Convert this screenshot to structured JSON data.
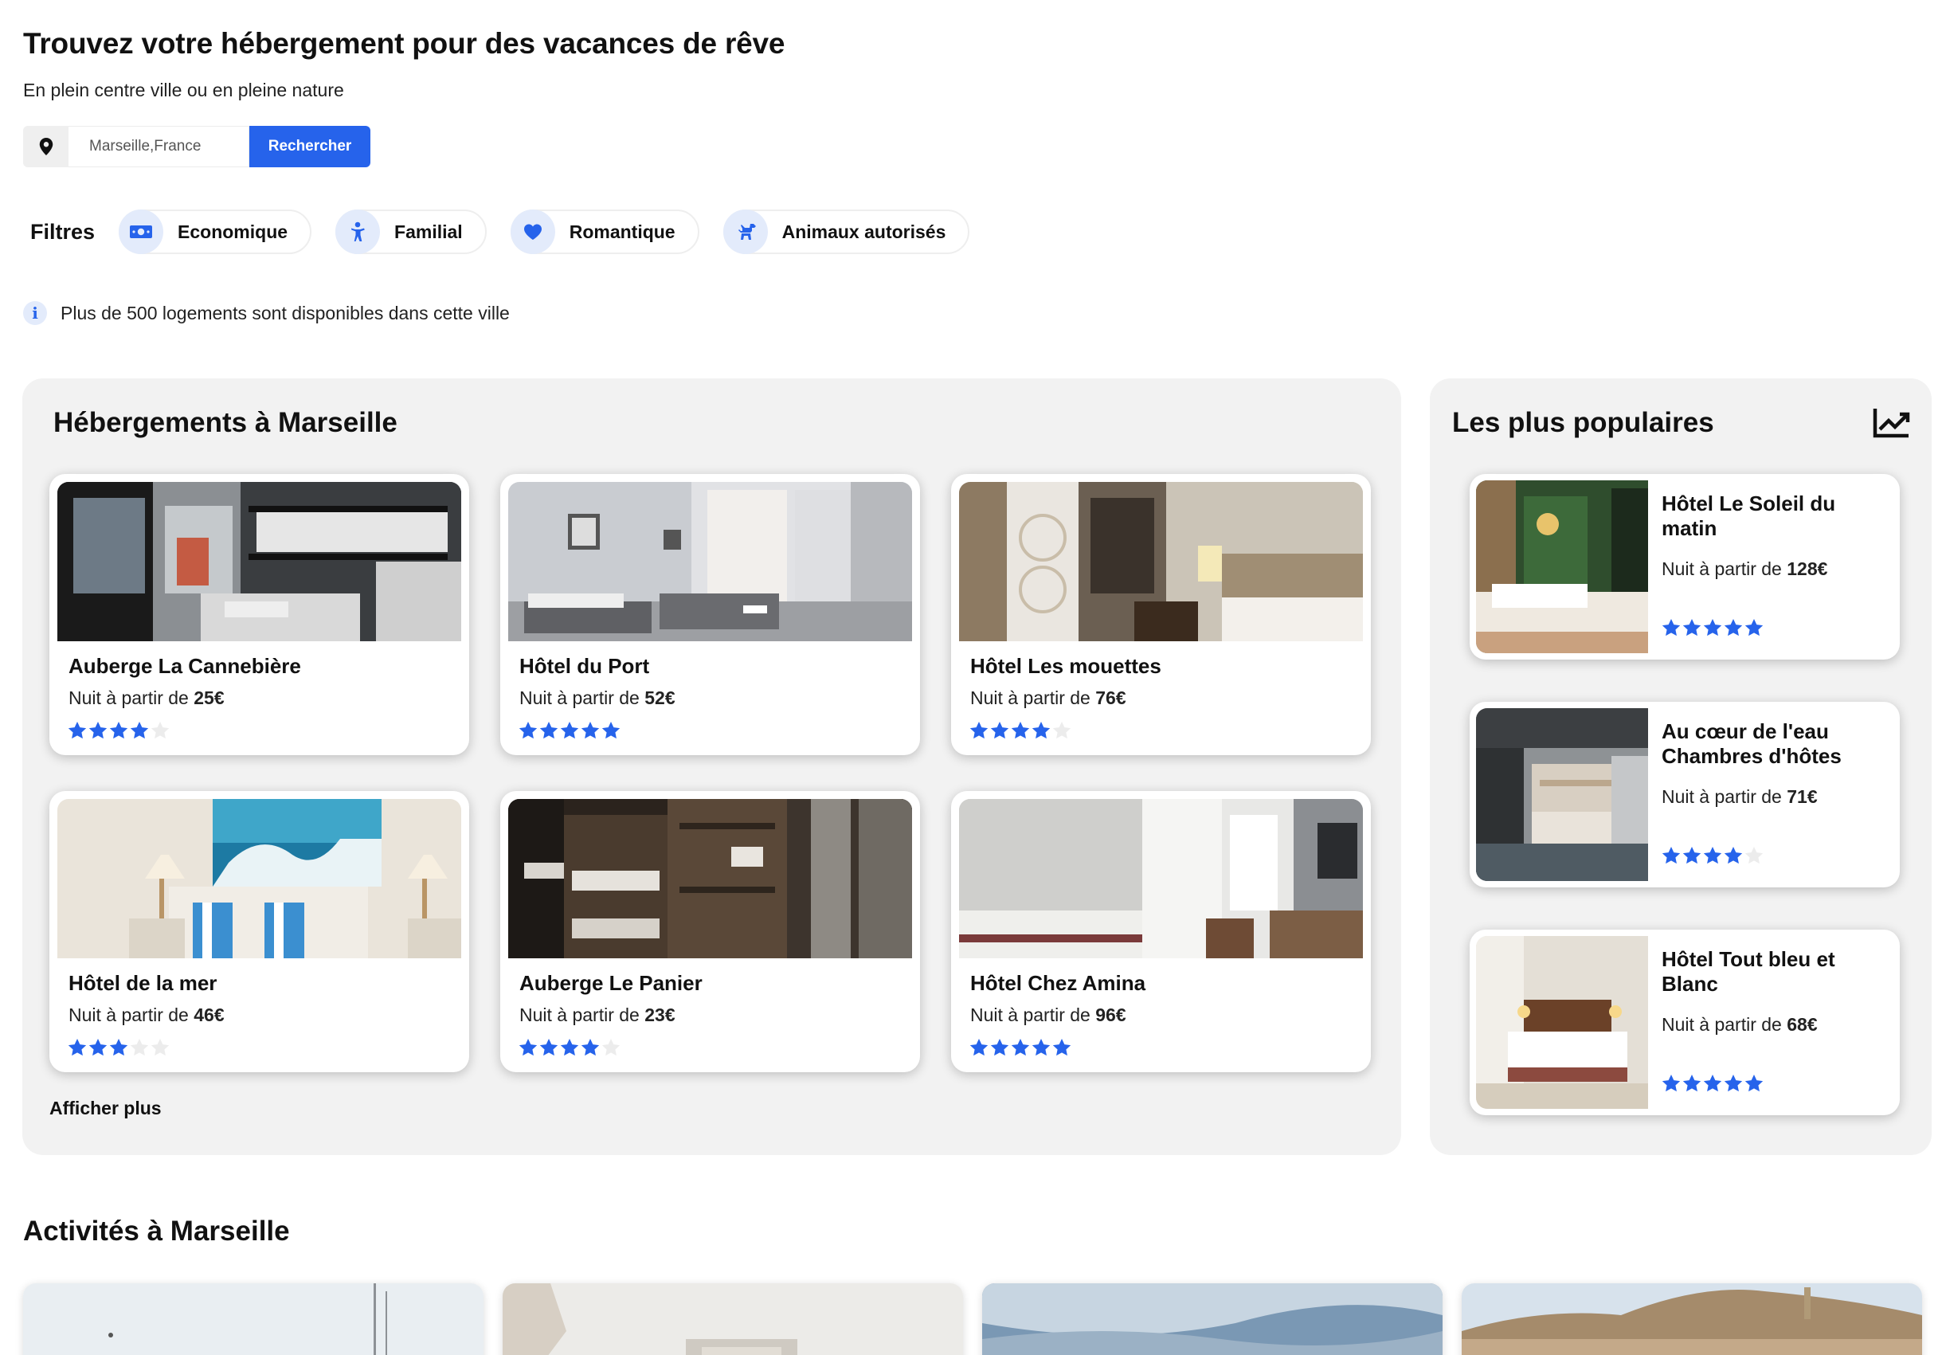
{
  "header": {
    "title": "Trouvez votre hébergement pour des vacances de rêve",
    "subtitle": "En plein centre ville ou en pleine nature"
  },
  "search": {
    "value": "Marseille,France",
    "button_label": "Rechercher",
    "icon": "location-pin-icon"
  },
  "filters": {
    "label": "Filtres",
    "items": [
      {
        "label": "Economique",
        "icon": "money-icon"
      },
      {
        "label": "Familial",
        "icon": "child-icon"
      },
      {
        "label": "Romantique",
        "icon": "heart-icon"
      },
      {
        "label": "Animaux autorisés",
        "icon": "dog-icon"
      }
    ]
  },
  "info": {
    "text": "Plus de 500 logements sont disponibles dans cette ville"
  },
  "listings": {
    "title": "Hébergements à Marseille",
    "price_prefix": "Nuit à partir de",
    "more_label": "Afficher plus",
    "items": [
      {
        "name": "Auberge La Cannebière",
        "price": "25€",
        "rating": 4
      },
      {
        "name": "Hôtel du Port",
        "price": "52€",
        "rating": 5
      },
      {
        "name": "Hôtel Les mouettes",
        "price": "76€",
        "rating": 4
      },
      {
        "name": "Hôtel de la mer",
        "price": "46€",
        "rating": 3
      },
      {
        "name": "Auberge Le Panier",
        "price": "23€",
        "rating": 4
      },
      {
        "name": "Hôtel Chez Amina",
        "price": "96€",
        "rating": 5
      }
    ]
  },
  "popular": {
    "title": "Les plus populaires",
    "icon": "trending-up-icon",
    "items": [
      {
        "name": "Hôtel Le Soleil du matin",
        "price": "128€",
        "rating": 5
      },
      {
        "name": "Au cœur de l'eau Chambres d'hôtes",
        "price": "71€",
        "rating": 4
      },
      {
        "name": "Hôtel Tout bleu et Blanc",
        "price": "68€",
        "rating": 5
      }
    ]
  },
  "activities": {
    "title": "Activités à Marseille"
  },
  "colors": {
    "accent": "#2663eb",
    "chip_bg": "#e3ebfb",
    "panel_bg": "#f2f2f2"
  }
}
